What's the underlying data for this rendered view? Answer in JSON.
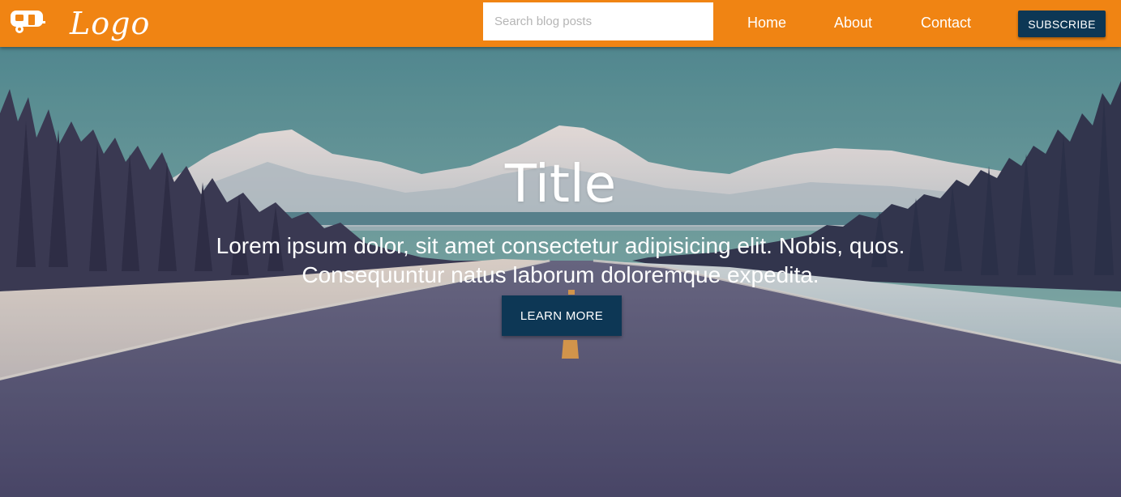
{
  "header": {
    "logo_text": "Logo",
    "brand_icon": "camper-trailer-icon",
    "search": {
      "placeholder": "Search blog posts",
      "value": ""
    },
    "nav": [
      {
        "label": "Home"
      },
      {
        "label": "About"
      },
      {
        "label": "Contact"
      }
    ],
    "subscribe_label": "SUBSCRIBE"
  },
  "hero": {
    "title": "Title",
    "text": "Lorem ipsum dolor, sit amet consectetur adipisicing elit. Nobis, quos. Consequuntur natus laborum doloremque expedita.",
    "button_label": "LEARN MORE",
    "background": "mountain-road-photo"
  },
  "colors": {
    "navbar": "#f08413",
    "button": "#0d3755",
    "text": "#ffffff"
  }
}
